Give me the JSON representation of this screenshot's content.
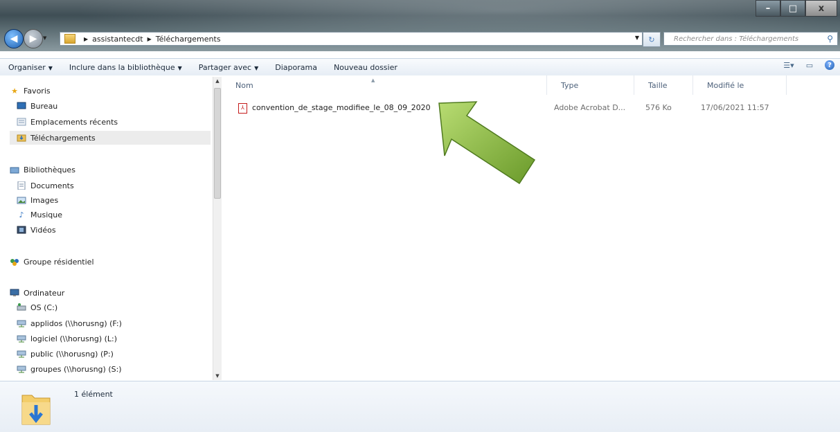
{
  "title_bar": {
    "controls": {
      "minimize": "–",
      "maximize": "□",
      "close": "x"
    }
  },
  "address_bar": {
    "path": [
      "assistantecdt",
      "Téléchargements"
    ],
    "search_placeholder": "Rechercher dans : Téléchargements"
  },
  "toolbar": {
    "items": [
      {
        "label": "Organiser",
        "dropdown": true
      },
      {
        "label": "Inclure dans la bibliothèque",
        "dropdown": true
      },
      {
        "label": "Partager avec",
        "dropdown": true
      },
      {
        "label": "Diaporama",
        "dropdown": false
      },
      {
        "label": "Nouveau dossier",
        "dropdown": false
      }
    ]
  },
  "nav_pane": {
    "favorites": {
      "label": "Favoris",
      "items": [
        "Bureau",
        "Emplacements récents",
        "Téléchargements"
      ]
    },
    "libraries": {
      "label": "Bibliothèques",
      "items": [
        "Documents",
        "Images",
        "Musique",
        "Vidéos"
      ]
    },
    "homegroup": {
      "label": "Groupe résidentiel"
    },
    "computer": {
      "label": "Ordinateur",
      "items": [
        "OS (C:)",
        "applidos (\\\\horusng) (F:)",
        "logiciel (\\\\horusng) (L:)",
        "public (\\\\horusng) (P:)",
        "groupes (\\\\horusng) (S:)"
      ]
    },
    "selected": "Téléchargements"
  },
  "file_list": {
    "columns": {
      "name": "Nom",
      "type": "Type",
      "size": "Taille",
      "modified": "Modifié le"
    },
    "rows": [
      {
        "name": "convention_de_stage_modifiee_le_08_09_2020",
        "type": "Adobe Acrobat D...",
        "size": "576 Ko",
        "modified": "17/06/2021 11:57"
      }
    ]
  },
  "status_bar": {
    "count_text": "1 élément"
  },
  "colors": {
    "arrow": "#7fb03a",
    "selection": "#ececec",
    "toolbar": "#e6edf5"
  }
}
